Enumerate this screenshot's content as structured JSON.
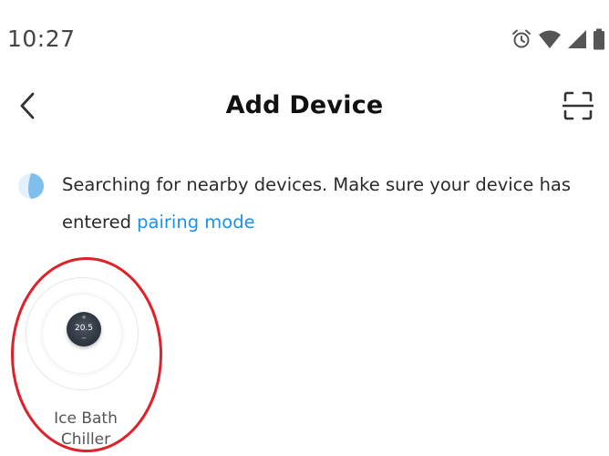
{
  "status_bar": {
    "time": "10:27",
    "icons": [
      "alarm-icon",
      "wifi-icon",
      "signal-icon",
      "battery-icon"
    ]
  },
  "header": {
    "title": "Add Device",
    "back_icon": "chevron-left-icon",
    "scan_icon": "scan-icon"
  },
  "search": {
    "message": "Searching for nearby devices. Make sure your device has entered ",
    "link_text": "pairing mode",
    "link_color": "#1e90e8"
  },
  "devices": [
    {
      "name": "Ice Bath\nChiller",
      "display_reading": "20.5",
      "display_plus": "+",
      "display_minus": "−"
    }
  ],
  "colors": {
    "annotation": "#e0202a",
    "accent": "#1e90e8"
  }
}
